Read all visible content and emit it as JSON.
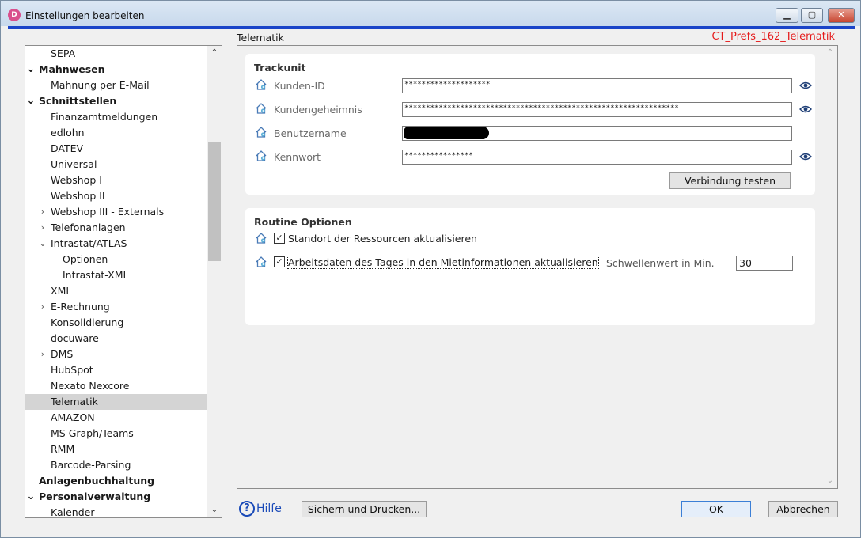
{
  "window": {
    "title": "Einstellungen bearbeiten",
    "app_icon_letter": "D",
    "buttons": {
      "minimize": "▁",
      "maximize": "▢",
      "close": "✕"
    }
  },
  "tree": {
    "items": [
      {
        "label": "SEPA",
        "level": 1,
        "bold": false,
        "arrow": "",
        "selected": false
      },
      {
        "label": "Mahnwesen",
        "level": 0,
        "bold": true,
        "arrow": "⌄",
        "selected": false
      },
      {
        "label": "Mahnung per E-Mail",
        "level": 1,
        "bold": false,
        "arrow": "",
        "selected": false
      },
      {
        "label": "Schnittstellen",
        "level": 0,
        "bold": true,
        "arrow": "⌄",
        "selected": false
      },
      {
        "label": "Finanzamtmeldungen",
        "level": 1,
        "bold": false,
        "arrow": "",
        "selected": false
      },
      {
        "label": "edlohn",
        "level": 1,
        "bold": false,
        "arrow": "",
        "selected": false
      },
      {
        "label": "DATEV",
        "level": 1,
        "bold": false,
        "arrow": "",
        "selected": false
      },
      {
        "label": "Universal",
        "level": 1,
        "bold": false,
        "arrow": "",
        "selected": false
      },
      {
        "label": "Webshop I",
        "level": 1,
        "bold": false,
        "arrow": "",
        "selected": false
      },
      {
        "label": "Webshop II",
        "level": 1,
        "bold": false,
        "arrow": "",
        "selected": false
      },
      {
        "label": "Webshop III - Externals",
        "level": 1,
        "bold": false,
        "arrow": "›",
        "selected": false
      },
      {
        "label": "Telefonanlagen",
        "level": 1,
        "bold": false,
        "arrow": "›",
        "selected": false
      },
      {
        "label": "Intrastat/ATLAS",
        "level": 1,
        "bold": false,
        "arrow": "⌄",
        "selected": false
      },
      {
        "label": "Optionen",
        "level": 2,
        "bold": false,
        "arrow": "",
        "selected": false
      },
      {
        "label": "Intrastat-XML",
        "level": 2,
        "bold": false,
        "arrow": "",
        "selected": false
      },
      {
        "label": "XML",
        "level": 1,
        "bold": false,
        "arrow": "",
        "selected": false
      },
      {
        "label": "E-Rechnung",
        "level": 1,
        "bold": false,
        "arrow": "›",
        "selected": false
      },
      {
        "label": "Konsolidierung",
        "level": 1,
        "bold": false,
        "arrow": "",
        "selected": false
      },
      {
        "label": "docuware",
        "level": 1,
        "bold": false,
        "arrow": "",
        "selected": false
      },
      {
        "label": "DMS",
        "level": 1,
        "bold": false,
        "arrow": "›",
        "selected": false
      },
      {
        "label": "HubSpot",
        "level": 1,
        "bold": false,
        "arrow": "",
        "selected": false
      },
      {
        "label": "Nexato Nexcore",
        "level": 1,
        "bold": false,
        "arrow": "",
        "selected": false
      },
      {
        "label": "Telematik",
        "level": 1,
        "bold": false,
        "arrow": "",
        "selected": true
      },
      {
        "label": "AMAZON",
        "level": 1,
        "bold": false,
        "arrow": "",
        "selected": false
      },
      {
        "label": "MS Graph/Teams",
        "level": 1,
        "bold": false,
        "arrow": "",
        "selected": false
      },
      {
        "label": "RMM",
        "level": 1,
        "bold": false,
        "arrow": "",
        "selected": false
      },
      {
        "label": "Barcode-Parsing",
        "level": 1,
        "bold": false,
        "arrow": "",
        "selected": false
      },
      {
        "label": "Anlagenbuchhaltung",
        "level": 0,
        "bold": true,
        "arrow": "",
        "selected": false
      },
      {
        "label": "Personalverwaltung",
        "level": 0,
        "bold": true,
        "arrow": "⌄",
        "selected": false
      },
      {
        "label": "Kalender",
        "level": 1,
        "bold": false,
        "arrow": "",
        "selected": false
      }
    ]
  },
  "page": {
    "section_title": "Telematik",
    "pref_id": "CT_Prefs_162_Telematik"
  },
  "trackunit": {
    "title": "Trackunit",
    "fields": [
      {
        "label": "Kunden-ID",
        "value": "********************",
        "eye": true,
        "redacted": false
      },
      {
        "label": "Kundengeheimnis",
        "value": "****************************************************************",
        "eye": true,
        "redacted": false
      },
      {
        "label": "Benutzername",
        "value": "",
        "eye": false,
        "redacted": true
      },
      {
        "label": "Kennwort",
        "value": "****************",
        "eye": true,
        "redacted": false
      }
    ],
    "test_button": "Verbindung testen"
  },
  "routine": {
    "title": "Routine Optionen",
    "option1": {
      "label": "Standort der Ressourcen aktualisieren",
      "checked": true
    },
    "option2": {
      "label": "Arbeitsdaten des Tages in den Mietinformationen aktualisieren",
      "checked": true
    },
    "threshold_label": "Schwellenwert in Min.",
    "threshold_value": "30"
  },
  "footer": {
    "help_icon": "?",
    "help_label": "Hilfe",
    "save_print": "Sichern und Drucken...",
    "ok": "OK",
    "cancel": "Abbrechen"
  },
  "colors": {
    "accent_bar": "#1a44c8",
    "pref_id": "#e51a1a",
    "help_link": "#1a4ab8"
  }
}
